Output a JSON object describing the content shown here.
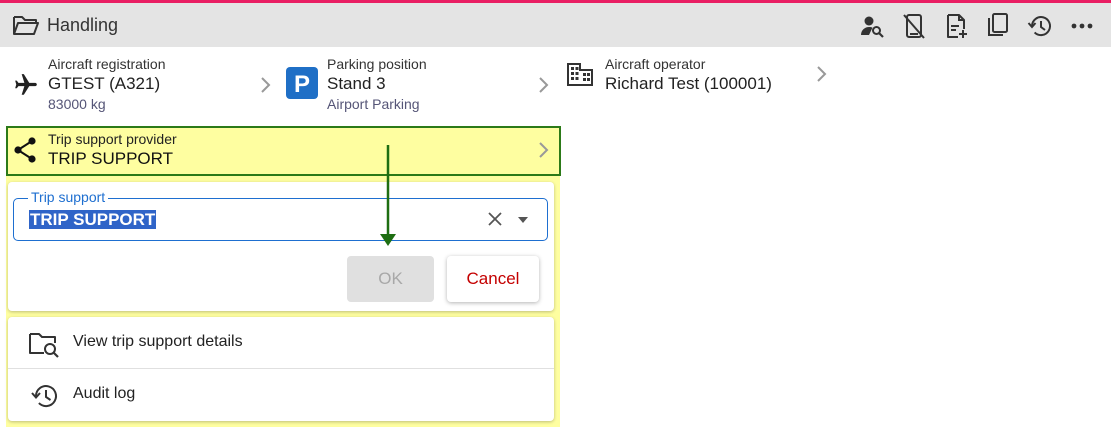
{
  "header": {
    "title": "Handling",
    "folder_icon": "folder-open-icon",
    "actions": [
      {
        "name": "person-search-icon"
      },
      {
        "name": "mobile-off-icon"
      },
      {
        "name": "note-add-icon"
      },
      {
        "name": "copy-icon"
      },
      {
        "name": "history-icon"
      },
      {
        "name": "more-horizontal-icon"
      }
    ]
  },
  "tiles": {
    "aircraft": {
      "label": "Aircraft registration",
      "value": "GTEST (A321)",
      "sub": "83000 kg",
      "icon": "airplane-icon"
    },
    "parking": {
      "label": "Parking position",
      "value": "Stand 3",
      "sub": "Airport Parking",
      "icon": "parking-icon",
      "icon_letter": "P",
      "icon_color": "#1f6fc6"
    },
    "operator": {
      "label": "Aircraft operator",
      "value": "Richard Test (100001)",
      "icon": "building-icon"
    }
  },
  "trip_support_provider": {
    "label": "Trip support provider",
    "value": "TRIP SUPPORT",
    "icon": "share-icon"
  },
  "edit_card": {
    "field_label": "Trip support",
    "field_value": "TRIP SUPPORT",
    "ok_label": "OK",
    "cancel_label": "Cancel"
  },
  "menu": {
    "items": [
      {
        "label": "View trip support details",
        "icon": "folder-search-icon"
      },
      {
        "label": "Audit log",
        "icon": "history-icon"
      }
    ]
  },
  "colors": {
    "accent": "#e91e63",
    "highlight": "#fefea0",
    "outline": "#2c7a18",
    "focus": "#1e6fd0",
    "danger": "#c40000"
  }
}
